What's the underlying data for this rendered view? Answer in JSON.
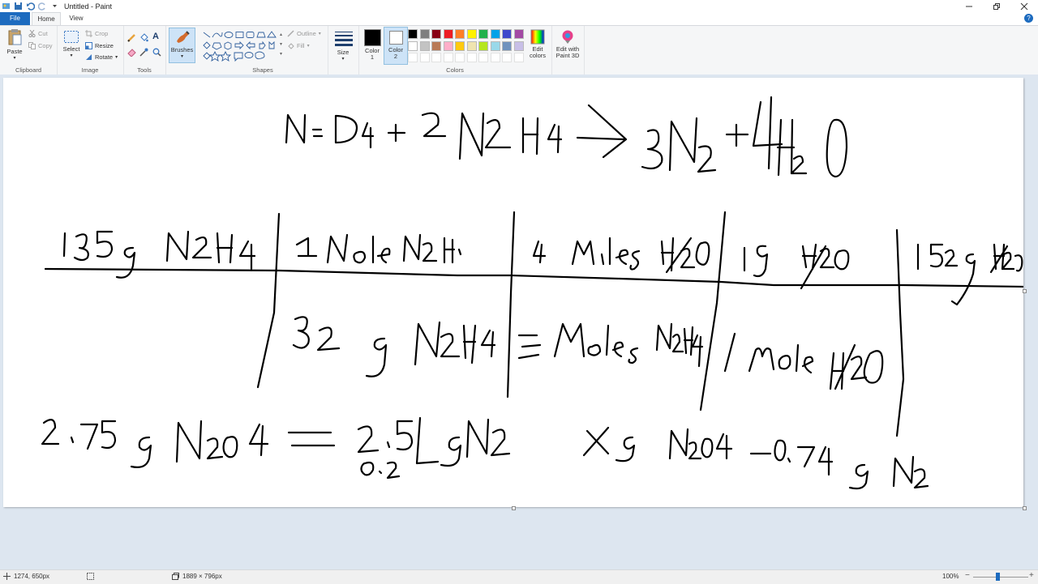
{
  "window": {
    "title": "Untitled - Paint"
  },
  "tabs": {
    "file": "File",
    "home": "Home",
    "view": "View"
  },
  "clipboard": {
    "paste": "Paste",
    "cut": "Cut",
    "copy": "Copy",
    "label": "Clipboard"
  },
  "image": {
    "select": "Select",
    "crop": "Crop",
    "resize": "Resize",
    "rotate": "Rotate",
    "label": "Image"
  },
  "tools": {
    "label": "Tools"
  },
  "brushes": {
    "label": "Brushes"
  },
  "shapes": {
    "outline": "Outline",
    "fill": "Fill",
    "label": "Shapes"
  },
  "size": {
    "label": "Size"
  },
  "colors": {
    "color1_label": "Color",
    "color1_num": "1",
    "color2_label": "Color",
    "color2_num": "2",
    "edit_label": "Edit",
    "edit_label2": "colors",
    "label": "Colors",
    "paint3d_label": "Edit with",
    "paint3d_label2": "Paint 3D",
    "color1": "#000000",
    "color2": "#ffffff",
    "palette_row1": [
      "#000000",
      "#7f7f7f",
      "#880015",
      "#ed1c24",
      "#ff7f27",
      "#fff200",
      "#22b14c",
      "#00a2e8",
      "#3f48cc",
      "#a349a4"
    ],
    "palette_row2": [
      "#ffffff",
      "#c3c3c3",
      "#b97a57",
      "#ffaec9",
      "#ffc90e",
      "#efe4b0",
      "#b5e61d",
      "#99d9ea",
      "#7092be",
      "#c8bfe7"
    ]
  },
  "status": {
    "cursor": "1274, 650px",
    "size": "1889 × 796px",
    "zoom": "100%"
  }
}
